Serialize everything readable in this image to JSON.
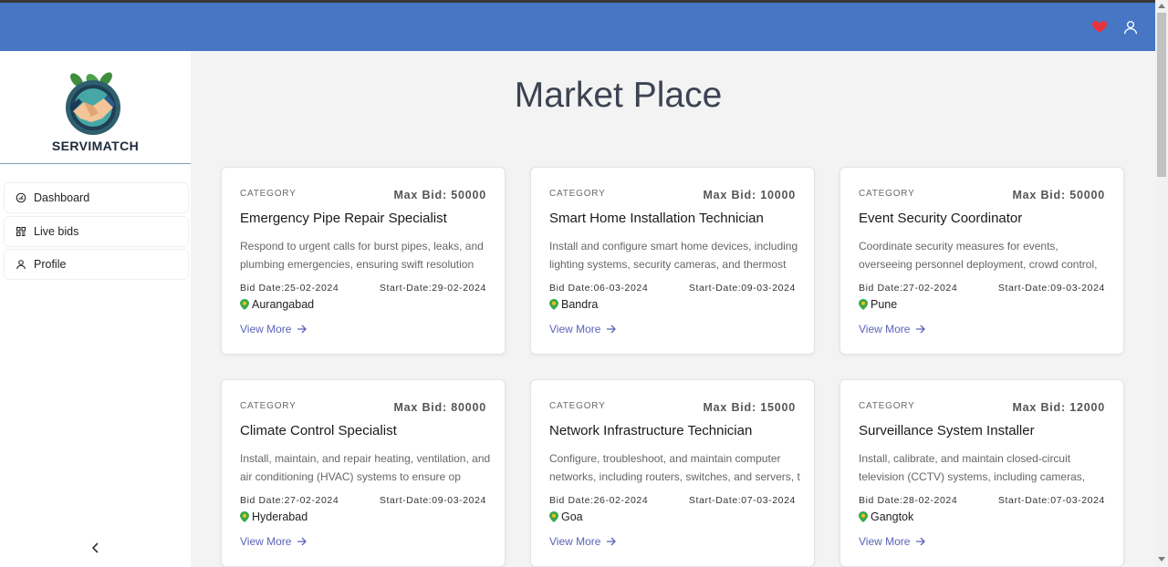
{
  "header": {
    "icons": [
      "heart-icon",
      "user-icon"
    ],
    "accent_color": "#4676c4",
    "heart_color": "#e8333c"
  },
  "brand": {
    "name": "SERVIMATCH"
  },
  "sidebar": {
    "items": [
      {
        "label": "Dashboard",
        "icon": "dashboard-icon"
      },
      {
        "label": "Live bids",
        "icon": "grid-icon"
      },
      {
        "label": "Profile",
        "icon": "user-icon"
      }
    ],
    "collapse_glyph": "<"
  },
  "main": {
    "title": "Market Place",
    "cards": [
      {
        "category": "CATEGORY",
        "max_bid": "Max Bid: 50000",
        "title": "Emergency Pipe Repair Specialist",
        "description": "Respond to urgent calls for burst pipes, leaks, and plumbing emergencies, ensuring swift resolution",
        "bid_date": "Bid Date:25-02-2024",
        "start_date": "Start-Date:29-02-2024",
        "location": "Aurangabad",
        "link": "View More"
      },
      {
        "category": "CATEGORY",
        "max_bid": "Max Bid: 10000",
        "title": "Smart Home Installation Technician",
        "description": "Install and configure smart home devices, including lighting systems, security cameras, and thermost",
        "bid_date": "Bid Date:06-03-2024",
        "start_date": "Start-Date:09-03-2024",
        "location": "Bandra",
        "link": "View More"
      },
      {
        "category": "CATEGORY",
        "max_bid": "Max Bid: 50000",
        "title": "Event Security Coordinator",
        "description": "Coordinate security measures for events, overseeing personnel deployment, crowd control, and emerge",
        "bid_date": "Bid Date:27-02-2024",
        "start_date": "Start-Date:09-03-2024",
        "location": "Pune",
        "link": "View More"
      },
      {
        "category": "CATEGORY",
        "max_bid": "Max Bid: 80000",
        "title": "Climate Control Specialist",
        "description": "Install, maintain, and repair heating, ventilation, and air conditioning (HVAC) systems to ensure op",
        "bid_date": "Bid Date:27-02-2024",
        "start_date": "Start-Date:09-03-2024",
        "location": "Hyderabad",
        "link": "View More"
      },
      {
        "category": "CATEGORY",
        "max_bid": "Max Bid: 15000",
        "title": "Network Infrastructure Technician",
        "description": "Configure, troubleshoot, and maintain computer networks, including routers, switches, and servers, t",
        "bid_date": "Bid Date:26-02-2024",
        "start_date": "Start-Date:07-03-2024",
        "location": "Goa",
        "link": "View More"
      },
      {
        "category": "CATEGORY",
        "max_bid": "Max Bid: 12000",
        "title": "Surveillance System Installer",
        "description": "Install, calibrate, and maintain closed-circuit television (CCTV) systems, including cameras, recor",
        "bid_date": "Bid Date:28-02-2024",
        "start_date": "Start-Date:07-03-2024",
        "location": "Gangtok",
        "link": "View More"
      }
    ]
  }
}
